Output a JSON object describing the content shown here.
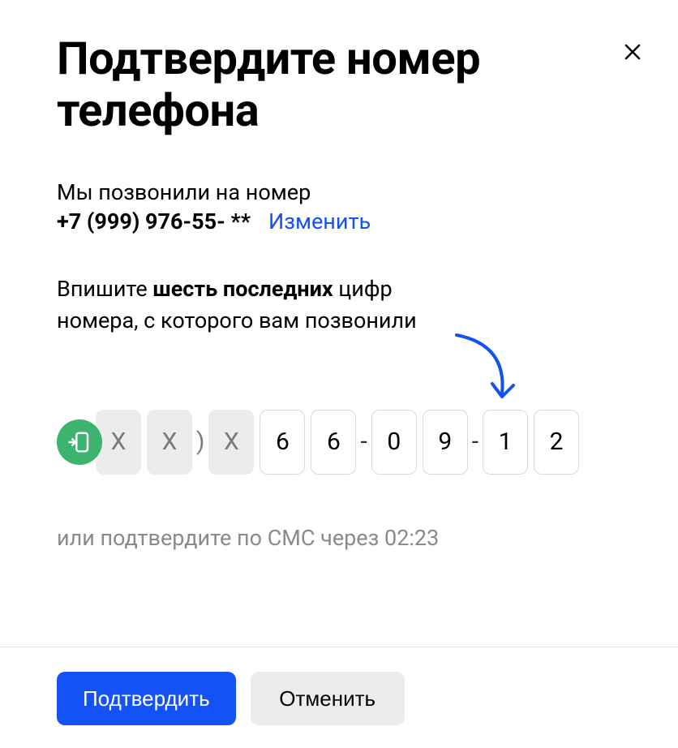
{
  "title": "Подтвердите номер телефона",
  "call_info": "Мы позвонили на номер",
  "phone_masked": "+7 (999) 976-55- **",
  "change_link": "Изменить",
  "instruction_pre": "Впишите ",
  "instruction_bold": "шесть последних",
  "instruction_post": " цифр номера, с которого вам позвонили",
  "placeholder_digits": [
    "X",
    "X",
    "X"
  ],
  "input_digits": [
    "6",
    "6",
    "0",
    "9",
    "1",
    "2"
  ],
  "separator_paren": ")",
  "separator_dash": "-",
  "sms_text_pre": "или подтвердите по СМС через ",
  "sms_timer": "02:23",
  "buttons": {
    "confirm": "Подтвердить",
    "cancel": "Отменить"
  }
}
